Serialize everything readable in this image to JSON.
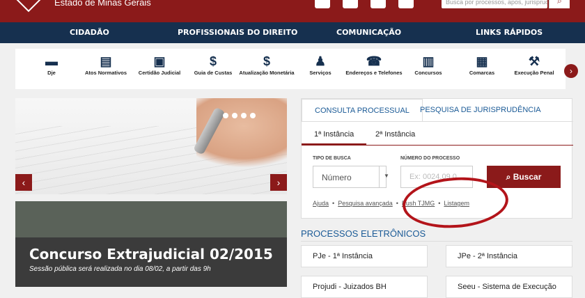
{
  "header": {
    "logo_text": "Estado de Minas Gerais",
    "search_placeholder": "Busca por processos, apos, jurisprudência"
  },
  "nav": {
    "items": [
      "CIDADÃO",
      "PROFISSIONAIS DO DIREITO",
      "COMUNICAÇÃO",
      "LINKS RÁPIDOS"
    ]
  },
  "quicklinks": [
    {
      "label": "Dje",
      "icon": "book-icon"
    },
    {
      "label": "Atos Normativos",
      "icon": "document-icon"
    },
    {
      "label": "Certidão Judicial",
      "icon": "certificate-icon"
    },
    {
      "label": "Guia de Custas",
      "icon": "fee-guide-icon"
    },
    {
      "label": "Atualização Monetária",
      "icon": "dollar-icon"
    },
    {
      "label": "Serviços",
      "icon": "person-icon"
    },
    {
      "label": "Endereços e Telefones",
      "icon": "phone-icon"
    },
    {
      "label": "Concursos",
      "icon": "list-icon"
    },
    {
      "label": "Comarcas",
      "icon": "calendar-icon"
    },
    {
      "label": "Execução Penal",
      "icon": "gavel-icon"
    }
  ],
  "news": {
    "title": "Concurso Extrajudicial 02/2015",
    "subtitle": "Sessão pública será realizada no dia 08/02, a partir das 9h"
  },
  "consulta": {
    "tabs": [
      "CONSULTA PROCESSUAL",
      "PESQUISA DE JURISPRUDÊNCIA"
    ],
    "subtabs": [
      "1ª Instância",
      "2ª Instância"
    ],
    "tipo_label": "TIPO DE BUSCA",
    "tipo_value": "Número",
    "numero_label": "NÚMERO DO PROCESSO",
    "numero_placeholder": "Ex: 0024.09.0",
    "buscar_label": "Buscar",
    "links": [
      "Ajuda",
      "Pesquisa avançada",
      "Push TJMG",
      "Listagem"
    ]
  },
  "processos": {
    "title": "PROCESSOS ELETRÔNICOS",
    "items": [
      "PJe - 1ª Instância",
      "JPe - 2ª Instância",
      "Projudi - Juizados BH",
      "Seeu - Sistema de Execução"
    ]
  },
  "colors": {
    "brand_red": "#8b1a1a",
    "nav_blue": "#16304f",
    "link_blue": "#1a5a96",
    "annotation_circle": "#b3141a"
  }
}
